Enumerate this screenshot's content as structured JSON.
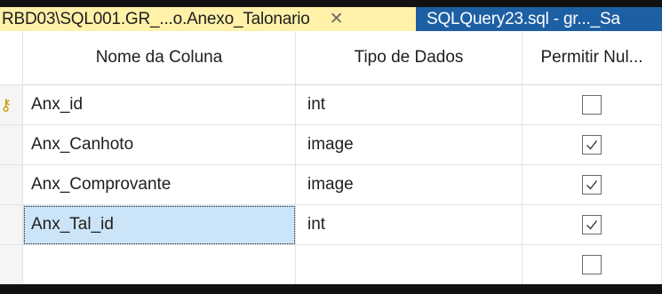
{
  "tabs": [
    {
      "label": "RBD03\\SQL001.GR_...o.Anexo_Talonario",
      "close_glyph": "✕",
      "active": true
    },
    {
      "label": "SQLQuery23.sql - gr..._Sa",
      "active": false
    }
  ],
  "columns": {
    "name": "Nome da Coluna",
    "type": "Tipo de Dados",
    "nulls": "Permitir Nul..."
  },
  "rows": [
    {
      "name": "Anx_id",
      "type": "int",
      "allow_nulls": false,
      "primary_key": true
    },
    {
      "name": "Anx_Canhoto",
      "type": "image",
      "allow_nulls": true,
      "primary_key": false
    },
    {
      "name": "Anx_Comprovante",
      "type": "image",
      "allow_nulls": true,
      "primary_key": false
    },
    {
      "name": "Anx_Tal_id",
      "type": "int",
      "allow_nulls": true,
      "primary_key": false,
      "selected": true
    },
    {
      "name": "",
      "type": "",
      "allow_nulls": false,
      "primary_key": false
    }
  ],
  "colors": {
    "active_tab_bg": "#fff1a8",
    "inactive_tab_bg": "#1d5fa3",
    "selection_bg": "#cce4f7",
    "key_icon": "#c69b00"
  },
  "icons": {
    "primary_key": "key-icon",
    "checkbox": "checkbox"
  }
}
